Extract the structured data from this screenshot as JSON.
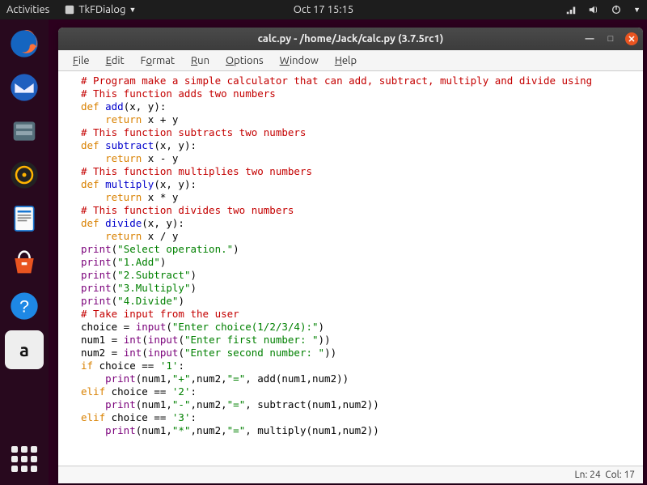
{
  "topbar": {
    "activities": "Activities",
    "app_indicator": "TkFDialog",
    "clock": "Oct 17  15:15"
  },
  "launcher": {
    "items": [
      {
        "name": "firefox"
      },
      {
        "name": "thunderbird"
      },
      {
        "name": "files"
      },
      {
        "name": "rhythmbox"
      },
      {
        "name": "writer"
      },
      {
        "name": "software"
      },
      {
        "name": "help"
      },
      {
        "name": "amazon"
      }
    ]
  },
  "window": {
    "title": "calc.py - /home/Jack/calc.py (3.7.5rc1)",
    "menus": [
      "File",
      "Edit",
      "Format",
      "Run",
      "Options",
      "Window",
      "Help"
    ],
    "status": {
      "ln": "Ln: 24",
      "col": "Col: 17"
    }
  },
  "code": {
    "lines": [
      {
        "t": "cm",
        "s": "# Program make a simple calculator that can add, subtract, multiply and divide using "
      },
      {
        "t": "cm",
        "s": "# This function adds two numbers"
      },
      {
        "t": "def",
        "name": "add",
        "args": "(x, y):"
      },
      {
        "t": "ret",
        "body": "x + y"
      },
      {
        "t": "cm",
        "s": "# This function subtracts two numbers"
      },
      {
        "t": "def",
        "name": "subtract",
        "args": "(x, y):"
      },
      {
        "t": "ret",
        "body": "x - y"
      },
      {
        "t": "cm",
        "s": "# This function multiplies two numbers"
      },
      {
        "t": "def",
        "name": "multiply",
        "args": "(x, y):"
      },
      {
        "t": "ret",
        "body": "x * y"
      },
      {
        "t": "cm",
        "s": "# This function divides two numbers"
      },
      {
        "t": "def",
        "name": "divide",
        "args": "(x, y):"
      },
      {
        "t": "ret",
        "body": "x / y"
      },
      {
        "t": "print",
        "str": "\"Select operation.\""
      },
      {
        "t": "print",
        "str": "\"1.Add\""
      },
      {
        "t": "print",
        "str": "\"2.Subtract\""
      },
      {
        "t": "print",
        "str": "\"3.Multiply\""
      },
      {
        "t": "print",
        "str": "\"4.Divide\""
      },
      {
        "t": "cm",
        "s": "# Take input from the user"
      },
      {
        "t": "assign",
        "lhs": "choice",
        "bi": "input",
        "str": "\"Enter choice(1/2/3/4):\""
      },
      {
        "t": "assignint",
        "lhs": "num1",
        "str": "\"Enter first number: \""
      },
      {
        "t": "assignint",
        "lhs": "num2",
        "str": "\"Enter second number: \""
      },
      {
        "t": "if",
        "cond": "choice == ",
        "str": "'1'"
      },
      {
        "t": "printcall",
        "args": "num1,\"+\"",
        "args2": ",num2,\"=\"",
        "fn": "add",
        "fargs": "(num1,num2))"
      },
      {
        "t": "elif",
        "cond": "choice == ",
        "str": "'2'"
      },
      {
        "t": "printcall",
        "args": "num1,\"-\"",
        "args2": ",num2,\"=\"",
        "fn": "subtract",
        "fargs": "(num1,num2))"
      },
      {
        "t": "elif",
        "cond": "choice == ",
        "str": "'3'"
      },
      {
        "t": "printcall",
        "args": "num1,\"*\"",
        "args2": ",num2,\"=\"",
        "fn": "multiply",
        "fargs": "(num1,num2))"
      }
    ]
  }
}
